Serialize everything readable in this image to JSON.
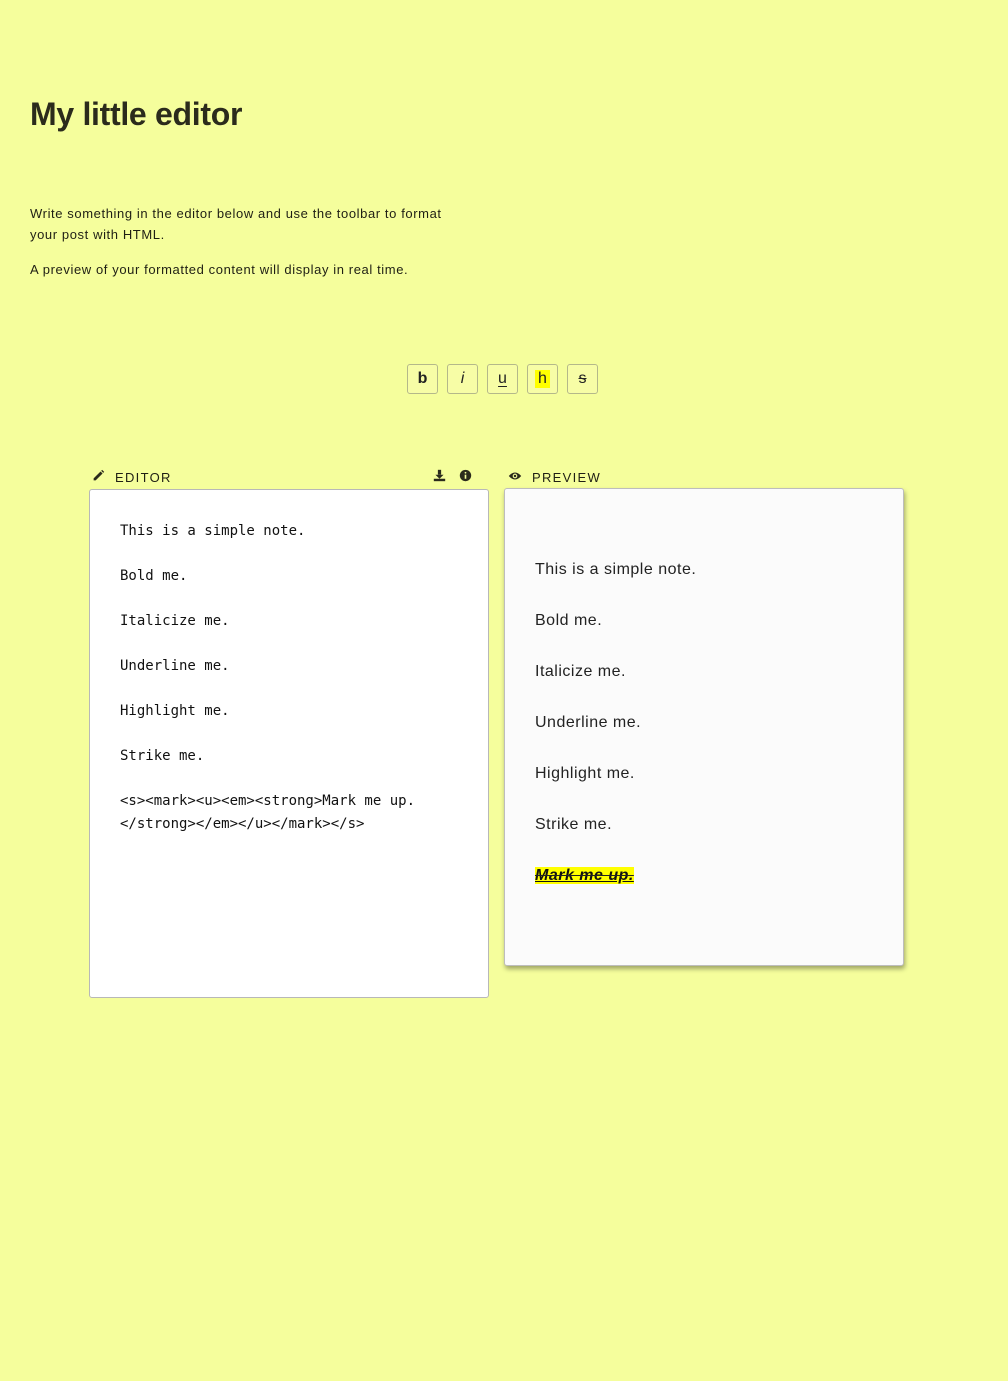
{
  "header": {
    "title": "My little editor",
    "intro": [
      "Write something in the editor below and use the toolbar to format your post with HTML.",
      "A preview of your formatted content will display in real time."
    ]
  },
  "toolbar": {
    "buttons": [
      {
        "label": "b",
        "action": "bold"
      },
      {
        "label": "i",
        "action": "italic"
      },
      {
        "label": "u",
        "action": "underline"
      },
      {
        "label": "h",
        "action": "highlight"
      },
      {
        "label": "s",
        "action": "strikethrough"
      }
    ]
  },
  "editor": {
    "label": "EDITOR",
    "icon": "pencil-icon",
    "actions": [
      "download-icon",
      "info-icon"
    ],
    "lines": [
      "This is a simple note.",
      "Bold me.",
      "Italicize me.",
      "Underline me.",
      "Highlight me.",
      "Strike me.",
      "<s><mark><u><em><strong>Mark me up.</strong></em></u></mark></s>"
    ]
  },
  "preview": {
    "label": "PREVIEW",
    "icon": "eye-icon",
    "lines": [
      "This is a simple note.",
      "Bold me.",
      "Italicize me.",
      "Underline me.",
      "Highlight me.",
      "Strike me."
    ],
    "marked_line": "Mark me up."
  },
  "colors": {
    "background": "#f5fe9c",
    "highlight": "#ffff00"
  }
}
